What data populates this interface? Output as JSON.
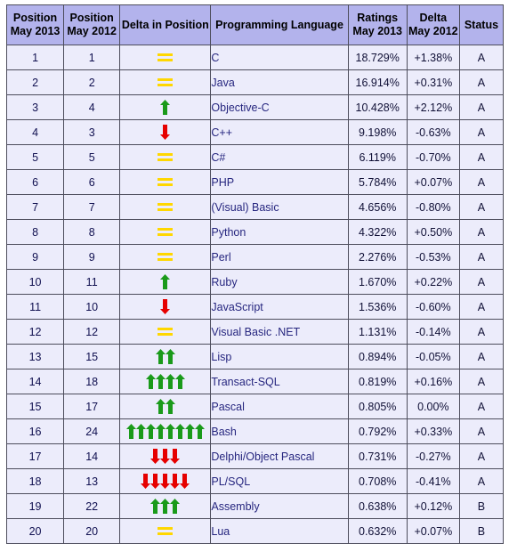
{
  "table": {
    "headers": [
      {
        "line1": "Position",
        "line2": "May 2013",
        "key": "position_2013"
      },
      {
        "line1": "Position",
        "line2": "May 2012",
        "key": "position_2012"
      },
      {
        "line1": "Delta in Position",
        "line2": "",
        "key": "delta_position"
      },
      {
        "line1": "Programming Language",
        "line2": "",
        "key": "language"
      },
      {
        "line1": "Ratings",
        "line2": "May 2013",
        "key": "ratings_2013"
      },
      {
        "line1": "Delta",
        "line2": "May 2012",
        "key": "delta_2012"
      },
      {
        "line1": "Status",
        "line2": "",
        "key": "status"
      }
    ],
    "rows": [
      {
        "position_2013": "1",
        "position_2012": "1",
        "delta_icon": "equals",
        "delta_count": 1,
        "language": "C",
        "ratings_2013": "18.729%",
        "delta_2012": "+1.38%",
        "status": "A"
      },
      {
        "position_2013": "2",
        "position_2012": "2",
        "delta_icon": "equals",
        "delta_count": 1,
        "language": "Java",
        "ratings_2013": "16.914%",
        "delta_2012": "+0.31%",
        "status": "A"
      },
      {
        "position_2013": "3",
        "position_2012": "4",
        "delta_icon": "arrow-up",
        "delta_count": 1,
        "language": "Objective-C",
        "ratings_2013": "10.428%",
        "delta_2012": "+2.12%",
        "status": "A"
      },
      {
        "position_2013": "4",
        "position_2012": "3",
        "delta_icon": "arrow-down",
        "delta_count": 1,
        "language": "C++",
        "ratings_2013": "9.198%",
        "delta_2012": "-0.63%",
        "status": "A"
      },
      {
        "position_2013": "5",
        "position_2012": "5",
        "delta_icon": "equals",
        "delta_count": 1,
        "language": "C#",
        "ratings_2013": "6.119%",
        "delta_2012": "-0.70%",
        "status": "A"
      },
      {
        "position_2013": "6",
        "position_2012": "6",
        "delta_icon": "equals",
        "delta_count": 1,
        "language": "PHP",
        "ratings_2013": "5.784%",
        "delta_2012": "+0.07%",
        "status": "A"
      },
      {
        "position_2013": "7",
        "position_2012": "7",
        "delta_icon": "equals",
        "delta_count": 1,
        "language": "(Visual) Basic",
        "ratings_2013": "4.656%",
        "delta_2012": "-0.80%",
        "status": "A"
      },
      {
        "position_2013": "8",
        "position_2012": "8",
        "delta_icon": "equals",
        "delta_count": 1,
        "language": "Python",
        "ratings_2013": "4.322%",
        "delta_2012": "+0.50%",
        "status": "A"
      },
      {
        "position_2013": "9",
        "position_2012": "9",
        "delta_icon": "equals",
        "delta_count": 1,
        "language": "Perl",
        "ratings_2013": "2.276%",
        "delta_2012": "-0.53%",
        "status": "A"
      },
      {
        "position_2013": "10",
        "position_2012": "11",
        "delta_icon": "arrow-up",
        "delta_count": 1,
        "language": "Ruby",
        "ratings_2013": "1.670%",
        "delta_2012": "+0.22%",
        "status": "A"
      },
      {
        "position_2013": "11",
        "position_2012": "10",
        "delta_icon": "arrow-down",
        "delta_count": 1,
        "language": "JavaScript",
        "ratings_2013": "1.536%",
        "delta_2012": "-0.60%",
        "status": "A"
      },
      {
        "position_2013": "12",
        "position_2012": "12",
        "delta_icon": "equals",
        "delta_count": 1,
        "language": "Visual Basic .NET",
        "ratings_2013": "1.131%",
        "delta_2012": "-0.14%",
        "status": "A"
      },
      {
        "position_2013": "13",
        "position_2012": "15",
        "delta_icon": "arrow-up",
        "delta_count": 2,
        "language": "Lisp",
        "ratings_2013": "0.894%",
        "delta_2012": "-0.05%",
        "status": "A"
      },
      {
        "position_2013": "14",
        "position_2012": "18",
        "delta_icon": "arrow-up",
        "delta_count": 4,
        "language": "Transact-SQL",
        "ratings_2013": "0.819%",
        "delta_2012": "+0.16%",
        "status": "A"
      },
      {
        "position_2013": "15",
        "position_2012": "17",
        "delta_icon": "arrow-up",
        "delta_count": 2,
        "language": "Pascal",
        "ratings_2013": "0.805%",
        "delta_2012": "0.00%",
        "status": "A"
      },
      {
        "position_2013": "16",
        "position_2012": "24",
        "delta_icon": "arrow-up",
        "delta_count": 8,
        "language": "Bash",
        "ratings_2013": "0.792%",
        "delta_2012": "+0.33%",
        "status": "A"
      },
      {
        "position_2013": "17",
        "position_2012": "14",
        "delta_icon": "arrow-down",
        "delta_count": 3,
        "language": "Delphi/Object Pascal",
        "ratings_2013": "0.731%",
        "delta_2012": "-0.27%",
        "status": "A"
      },
      {
        "position_2013": "18",
        "position_2012": "13",
        "delta_icon": "arrow-down",
        "delta_count": 5,
        "language": "PL/SQL",
        "ratings_2013": "0.708%",
        "delta_2012": "-0.41%",
        "status": "A"
      },
      {
        "position_2013": "19",
        "position_2012": "22",
        "delta_icon": "arrow-up",
        "delta_count": 3,
        "language": "Assembly",
        "ratings_2013": "0.638%",
        "delta_2012": "+0.12%",
        "status": "B"
      },
      {
        "position_2013": "20",
        "position_2012": "20",
        "delta_icon": "equals",
        "delta_count": 1,
        "language": "Lua",
        "ratings_2013": "0.632%",
        "delta_2012": "+0.07%",
        "status": "B"
      }
    ]
  },
  "colors": {
    "header_bg": "#b3b3ec",
    "row_bg": "#ececfb",
    "border": "#4d4d5c",
    "link_text": "#26267f",
    "arrow_up": "#1a9a1a",
    "arrow_down": "#e60000",
    "equals": "#ffd700"
  }
}
